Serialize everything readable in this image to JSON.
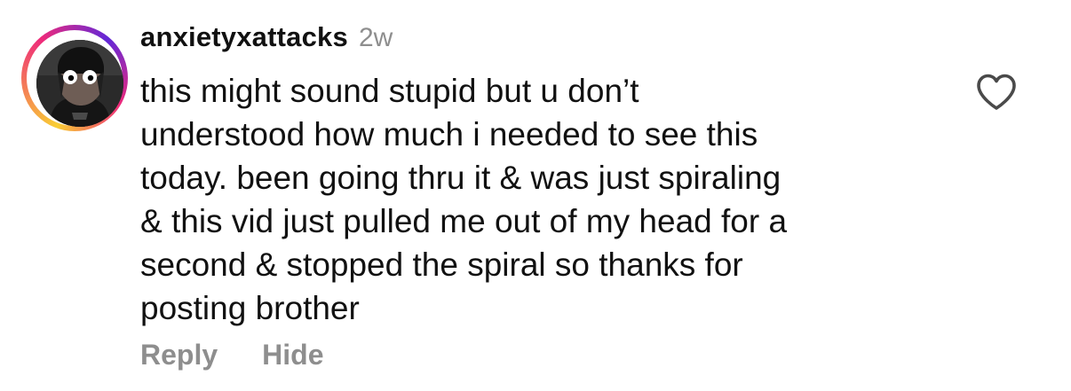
{
  "comment": {
    "username": "anxietyxattacks",
    "timestamp": "2w",
    "body_lines": [
      "this might sound stupid but u don’t",
      "understood how much i needed to see this",
      "today. been going thru it & was just spiraling",
      "& this vid just pulled me out of my head for a",
      "second & stopped the spiral so thanks for",
      "posting brother"
    ],
    "has_story_ring": true,
    "like_icon": "heart-outline-icon"
  },
  "actions": {
    "reply_label": "Reply",
    "hide_label": "Hide"
  },
  "colors": {
    "text": "#111111",
    "secondary": "#8e8e8e",
    "story_ring": [
      "#f9ce34",
      "#ee2a7b",
      "#6228d7"
    ]
  }
}
